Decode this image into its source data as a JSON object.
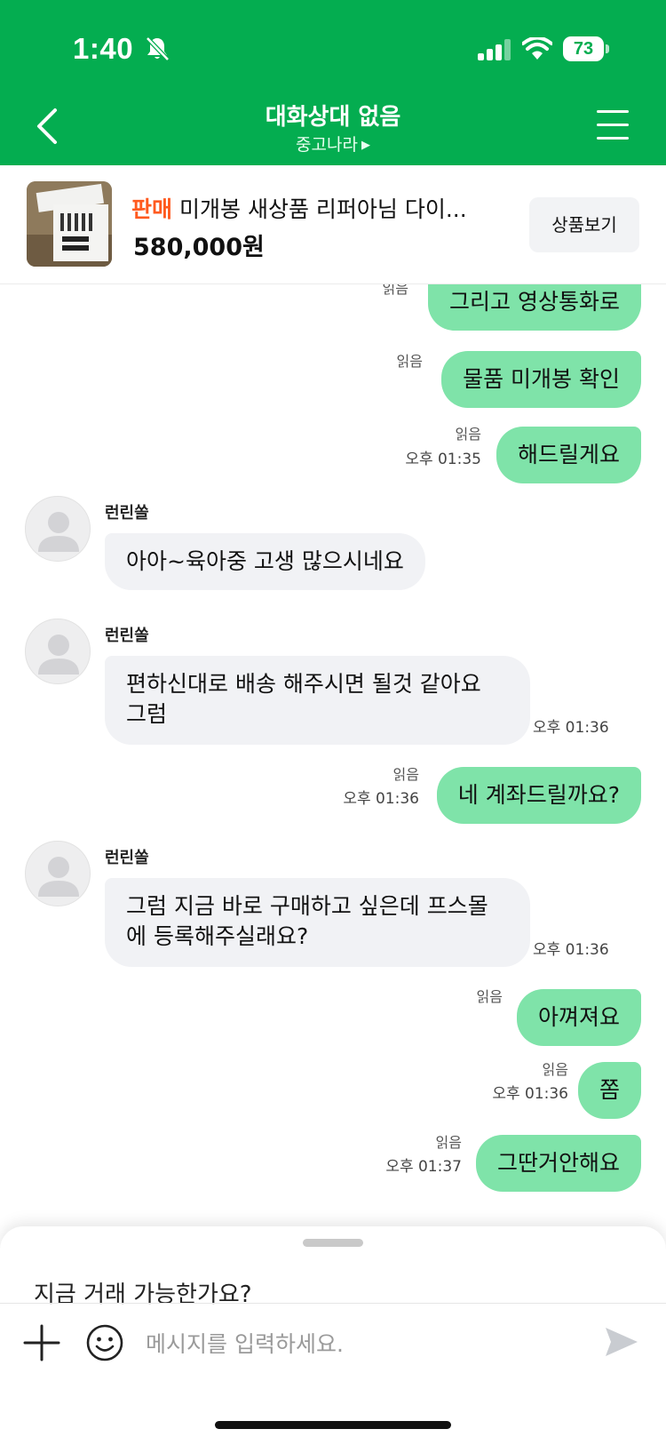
{
  "status_bar": {
    "time": "1:40",
    "battery": "73"
  },
  "header": {
    "title": "대화상대 없음",
    "subtitle": "중고나라"
  },
  "product": {
    "tag": "판매",
    "name": "미개봉 새상품 리퍼아님 다이...",
    "price": "580,000원",
    "view_button": "상품보기"
  },
  "messages": [
    {
      "side": "me",
      "text": "그리고 영상통화로",
      "read": "읽음"
    },
    {
      "side": "me",
      "text": "물품 미개봉 확인",
      "read": "읽음"
    },
    {
      "side": "me",
      "text": "해드릴게요",
      "read": "읽음",
      "time": "오후 01:35"
    },
    {
      "side": "them",
      "sender": "런린쏠",
      "text": "아아~육아중 고생 많으시네요"
    },
    {
      "side": "them",
      "sender": "런린쏠",
      "lines": [
        "편하신대로 배송 해주시면 될것 같아요",
        "그럼"
      ],
      "time": "오후 01:36"
    },
    {
      "side": "me",
      "text": "네 계좌드릴까요?",
      "read": "읽음",
      "time": "오후 01:36"
    },
    {
      "side": "them",
      "sender": "런린쏠",
      "lines": [
        "그럼 지금 바로 구매하고 싶은데 프스몰",
        "에 등록해주실래요?"
      ],
      "time": "오후 01:36"
    },
    {
      "side": "me",
      "text": "아껴져요",
      "read": "읽음"
    },
    {
      "side": "me",
      "text": "쫌",
      "read": "읽음",
      "time": "오후 01:36"
    },
    {
      "side": "me",
      "text": "그딴거안해요",
      "read": "읽음",
      "time": "오후 01:37"
    }
  ],
  "composer": {
    "quick_reply": "지금 거래 가능한가요?",
    "placeholder": "메시지를 입력하세요."
  },
  "colors": {
    "brand_green": "#04ad50",
    "my_bubble": "#7fe3a9",
    "their_bubble": "#f1f2f5",
    "sale_tag": "#ff5a1f"
  }
}
